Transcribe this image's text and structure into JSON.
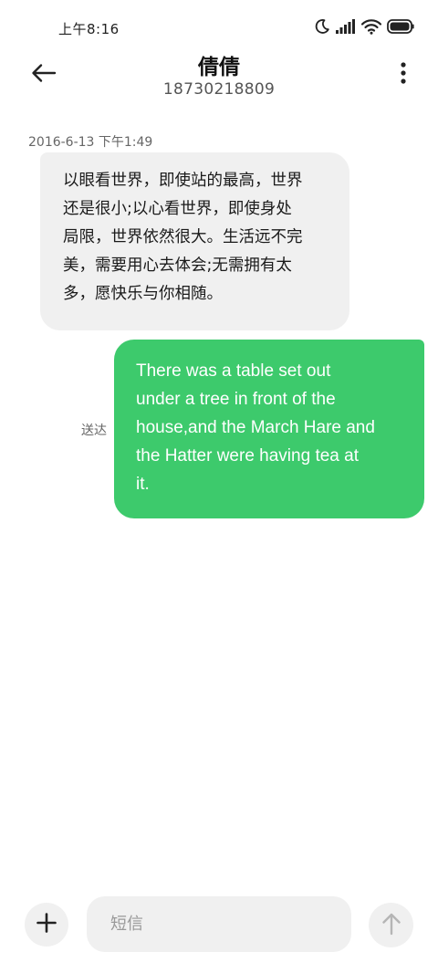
{
  "status_bar": {
    "time": "上午8:16",
    "icons": [
      "moon-icon",
      "signal-icon",
      "wifi-icon",
      "battery-icon"
    ]
  },
  "header": {
    "back_icon": "arrow-left-icon",
    "contact_name": "倩倩",
    "contact_number": "18730218809",
    "more_icon": "more-vertical-icon"
  },
  "conversation": {
    "timestamp": "2016-6-13 下午1:49",
    "incoming_message": {
      "lines": [
        "以眼看世界，即使站的最高，世界",
        "还是很小;以心看世界，即使身处",
        "局限，世界依然很大。生活远不完",
        "美，需要用心去体会;无需拥有太",
        "多，愿快乐与你相随。"
      ]
    },
    "outgoing_message": {
      "lines": [
        "There was a table set out",
        "under a tree in front of the",
        "house,and the March Hare and",
        "the Hatter were having tea at",
        "it."
      ],
      "status": "送达"
    }
  },
  "composer": {
    "add_icon": "plus-icon",
    "placeholder": "短信",
    "value": "",
    "send_icon": "arrow-up-icon"
  },
  "colors": {
    "outgoing_bubble": "#3dca6c",
    "incoming_bubble": "#f0f0f0",
    "background": "#ffffff"
  }
}
